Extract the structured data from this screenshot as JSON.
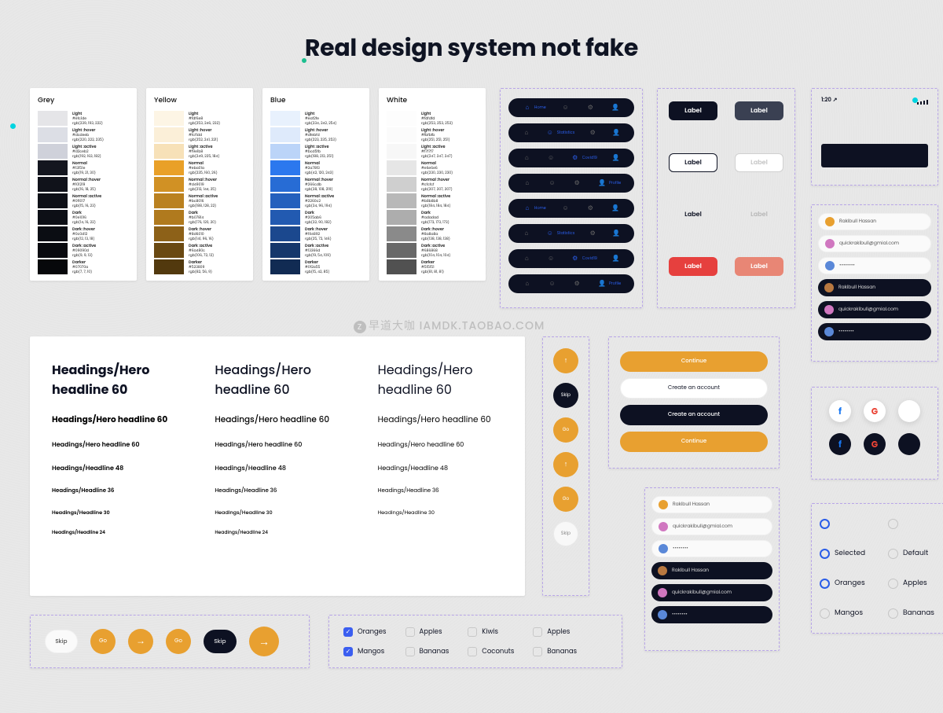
{
  "title": "Real design system not fake",
  "watermark": "早道大咖 IAMDK.TAOBAO.COM",
  "palettes": {
    "grey": {
      "title": "Grey",
      "swatches": [
        {
          "name": "Light",
          "hex": "#efc1de",
          "rgb": "rgb(239, 193, 222)",
          "color": "#e5e5e8"
        },
        {
          "name": "Light :hover",
          "hex": "#dcdeeb",
          "rgb": "rgb(220, 222, 235)",
          "color": "#dcdee5"
        },
        {
          "name": "Light :active",
          "hex": "#d2ceb2",
          "rgb": "rgb(192, 163, 182)",
          "color": "#cfd1da"
        },
        {
          "name": "Normal",
          "hex": "#13151e",
          "rgb": "rgb(19, 21, 30)",
          "color": "#14161f"
        },
        {
          "name": "Normal :hover",
          "hex": "#101219",
          "rgb": "rgb(16, 18, 25)",
          "color": "#10121a"
        },
        {
          "name": "Normal :active",
          "hex": "#0f1017",
          "rgb": "rgb(15, 16, 23)",
          "color": "#0e1017"
        },
        {
          "name": "Dark",
          "hex": "#0e1016",
          "rgb": "rgb(14, 16, 22)",
          "color": "#0d0f16"
        },
        {
          "name": "Dark :hover",
          "hex": "#0c0d12",
          "rgb": "rgb(12, 13, 18)",
          "color": "#0b0d13"
        },
        {
          "name": "Dark :active",
          "hex": "#09090d",
          "rgb": "rgb(9, 9, 13)",
          "color": "#090a0f"
        },
        {
          "name": "Darker",
          "hex": "#07070a",
          "rgb": "rgb(7, 7, 10)",
          "color": "#07080b"
        }
      ]
    },
    "yellow": {
      "title": "Yellow",
      "swatches": [
        {
          "name": "Light",
          "hex": "#fdf6e8",
          "rgb": "rgb(253, 246, 232)",
          "color": "#fdf5e5"
        },
        {
          "name": "Light :hover",
          "hex": "#fcf1dd",
          "rgb": "rgb(252, 241, 221)",
          "color": "#fbefd8"
        },
        {
          "name": "Light :active",
          "hex": "#f9e1b8",
          "rgb": "rgb(249, 225, 184)",
          "color": "#f7e1b8"
        },
        {
          "name": "Normal",
          "hex": "#eba01a",
          "rgb": "rgb(235, 160, 26)",
          "color": "#e9a028"
        },
        {
          "name": "Normal :hover",
          "hex": "#d49019",
          "rgb": "rgb(212, 144, 25)",
          "color": "#d19124"
        },
        {
          "name": "Normal :active",
          "hex": "#bc8016",
          "rgb": "rgb(188, 128, 22)",
          "color": "#ba8120"
        },
        {
          "name": "Dark",
          "hex": "#b07814",
          "rgb": "rgb(176, 120, 20)",
          "color": "#b07a1e"
        },
        {
          "name": "Dark :hover",
          "hex": "#8d6010",
          "rgb": "rgb(141, 96, 16)",
          "color": "#8d6118"
        },
        {
          "name": "Dark :active",
          "hex": "#6a480c",
          "rgb": "rgb(106, 72, 12)",
          "color": "#6a4912"
        },
        {
          "name": "Darker",
          "hex": "#523809",
          "rgb": "rgb(82, 56, 9)",
          "color": "#52390e"
        }
      ]
    },
    "blue": {
      "title": "Blue",
      "swatches": [
        {
          "name": "Light",
          "hex": "#eaf2fe",
          "rgb": "rgb(234, 242, 254)",
          "color": "#e8f1fd"
        },
        {
          "name": "Light :hover",
          "hex": "#dfebfd",
          "rgb": "rgb(223, 235, 253)",
          "color": "#deeafb"
        },
        {
          "name": "Light :active",
          "hex": "#bcd5fb",
          "rgb": "rgb(188, 213, 251)",
          "color": "#bbd4f8"
        },
        {
          "name": "Normal",
          "hex": "#2a78f3",
          "rgb": "rgb(42, 120, 243)",
          "color": "#2c78ee"
        },
        {
          "name": "Normal :hover",
          "hex": "#266cdb",
          "rgb": "rgb(38, 108, 219)",
          "color": "#276cd5"
        },
        {
          "name": "Normal :active",
          "hex": "#2260c2",
          "rgb": "rgb(34, 96, 194)",
          "color": "#2460bd"
        },
        {
          "name": "Dark",
          "hex": "#205ab6",
          "rgb": "rgb(32, 90, 182)",
          "color": "#225ab1"
        },
        {
          "name": "Dark :hover",
          "hex": "#194892",
          "rgb": "rgb(25, 72, 146)",
          "color": "#1b488e"
        },
        {
          "name": "Dark :active",
          "hex": "#13366d",
          "rgb": "rgb(19, 54, 109)",
          "color": "#15376b"
        },
        {
          "name": "Darker",
          "hex": "#0f2a55",
          "rgb": "rgb(15, 42, 85)",
          "color": "#112b53"
        }
      ]
    },
    "white": {
      "title": "White",
      "swatches": [
        {
          "name": "Light",
          "hex": "#fdfdfd",
          "rgb": "rgb(253, 253, 253)",
          "color": "#fdfdfd"
        },
        {
          "name": "Light :hover",
          "hex": "#fbfbfb",
          "rgb": "rgb(251, 251, 251)",
          "color": "#fbfbfb"
        },
        {
          "name": "Light :active",
          "hex": "#f7f7f7",
          "rgb": "rgb(247, 247, 247)",
          "color": "#f7f7f7"
        },
        {
          "name": "Normal",
          "hex": "#e6e6e6",
          "rgb": "rgb(230, 230, 230)",
          "color": "#e6e6e6"
        },
        {
          "name": "Normal :hover",
          "hex": "#cfcfcf",
          "rgb": "rgb(207, 207, 207)",
          "color": "#cfcfcf"
        },
        {
          "name": "Normal :active",
          "hex": "#b8b8b8",
          "rgb": "rgb(184, 184, 184)",
          "color": "#b8b8b8"
        },
        {
          "name": "Dark",
          "hex": "#adadad",
          "rgb": "rgb(173, 173, 173)",
          "color": "#adadad"
        },
        {
          "name": "Dark :hover",
          "hex": "#8a8a8a",
          "rgb": "rgb(138, 138, 138)",
          "color": "#8a8a8a"
        },
        {
          "name": "Dark :active",
          "hex": "#686868",
          "rgb": "rgb(104, 104, 104)",
          "color": "#686868"
        },
        {
          "name": "Darker",
          "hex": "#515151",
          "rgb": "rgb(81, 81, 81)",
          "color": "#515151"
        }
      ]
    }
  },
  "nav_labels": {
    "home": "Home",
    "statistics": "Statistics",
    "covid": "Covid19",
    "profile": "Profile"
  },
  "button_label": "Label",
  "phone_time": "1:20",
  "typography": {
    "h60": "Headings/Hero headline 60",
    "h48": "Headings/Headline 48",
    "h36": "Headings/Headline 36",
    "h30": "Headings/Headline 30",
    "h24": "Headings/Headline 24"
  },
  "pill_labels": {
    "skip": "Skip",
    "go": "Go"
  },
  "actions": {
    "continue": "Continue",
    "create": "Create an account"
  },
  "inputs": {
    "name": "Rakibull Hassan",
    "email": "quickrakibull@gmial.com",
    "pass": "••••••••"
  },
  "checkboxes": {
    "col1": [
      {
        "label": "Oranges",
        "checked": true
      },
      {
        "label": "Mangos",
        "checked": true
      }
    ],
    "col2": [
      {
        "label": "Apples",
        "checked": false
      },
      {
        "label": "Bananas",
        "checked": false
      }
    ],
    "col3": [
      {
        "label": "Kiwis",
        "checked": false
      },
      {
        "label": "Coconuts",
        "checked": false
      }
    ],
    "col4": [
      {
        "label": "Apples",
        "checked": false
      },
      {
        "label": "Bananas",
        "checked": false
      }
    ]
  },
  "radios": {
    "selected": "Selected",
    "default": "Default",
    "oranges": "Oranges",
    "apples": "Apples",
    "mangos": "Mangos",
    "bananas": "Bananas"
  }
}
